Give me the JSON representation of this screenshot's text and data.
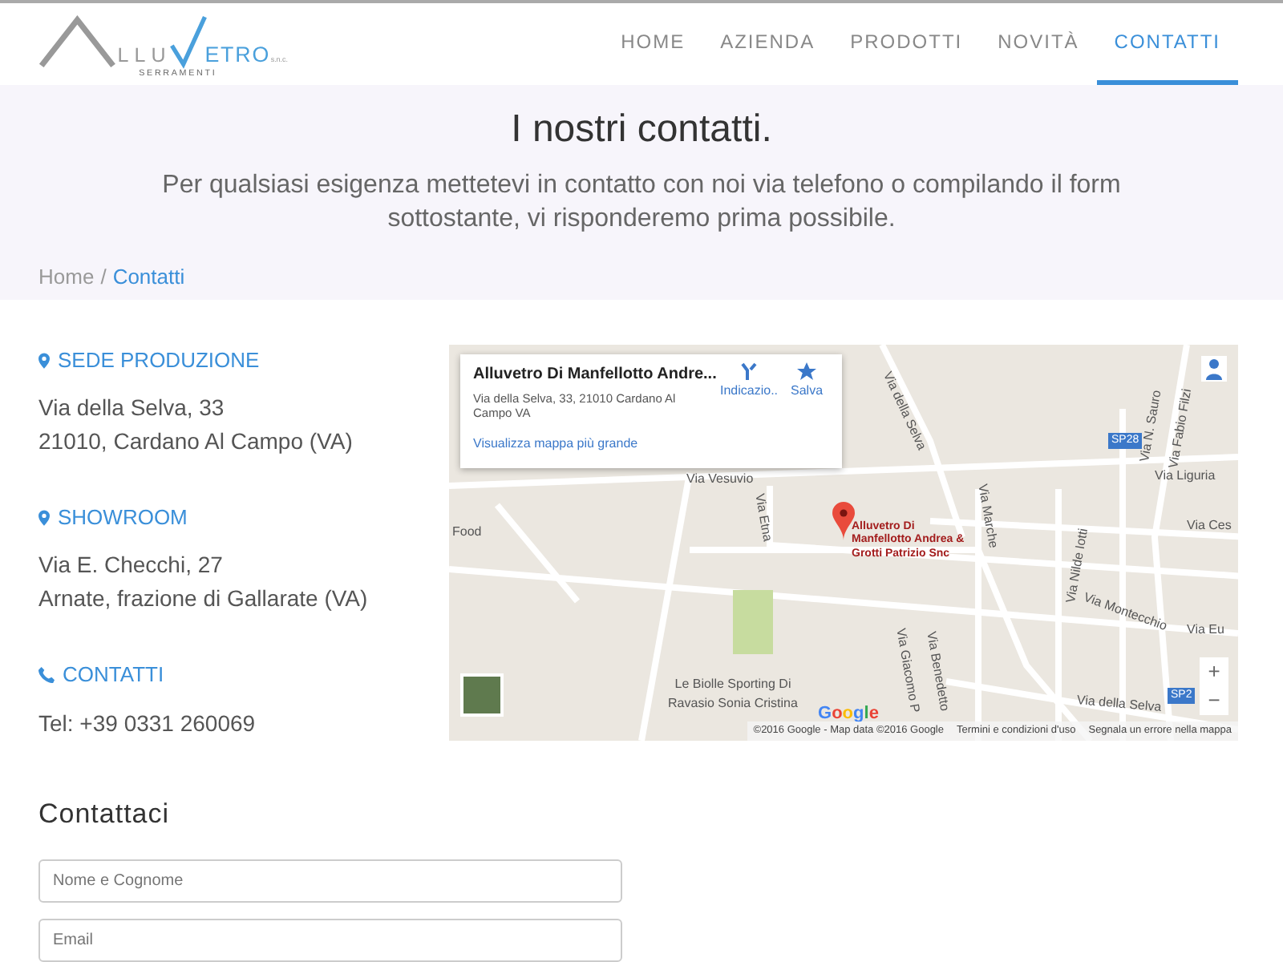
{
  "logo": {
    "text_1": "LLU",
    "text_2": "ETRO",
    "suffix": "s.n.c.",
    "tagline": "SERRAMENTI"
  },
  "nav": [
    {
      "label": "HOME",
      "selected": false
    },
    {
      "label": "AZIENDA",
      "selected": false
    },
    {
      "label": "PRODOTTI",
      "selected": false
    },
    {
      "label": "NOVITÀ",
      "selected": false
    },
    {
      "label": "CONTATTI",
      "selected": true
    }
  ],
  "hero": {
    "title": "I nostri contatti.",
    "subtitle": "Per qualsiasi esigenza mettetevi in contatto con noi via telefono o compilando il form sottostante, vi risponderemo prima possibile."
  },
  "breadcrumb": {
    "separator": "/",
    "items": [
      {
        "label": "Home",
        "selected": false
      },
      {
        "label": "Contatti",
        "selected": true
      }
    ]
  },
  "contacts": [
    {
      "kind": "pin",
      "title": "SEDE PRODUZIONE",
      "lines": [
        "Via della Selva, 33",
        "21010, Cardano Al Campo (VA)"
      ]
    },
    {
      "kind": "pin",
      "title": "SHOWROOM",
      "lines": [
        "Via E. Checchi, 27",
        "Arnate, frazione di Gallarate (VA)"
      ]
    },
    {
      "kind": "phone",
      "title": "CONTATTI",
      "lines": [
        "Tel: +39 0331 260069"
      ]
    }
  ],
  "map": {
    "card": {
      "title": "Alluvetro Di Manfellotto Andre...",
      "address": "Via della Selva, 33, 21010 Cardano Al Campo VA",
      "link": "Visualizza mappa più grande",
      "directions": "Indicazio..",
      "save": "Salva"
    },
    "pin_label": "Alluvetro Di Manfellotto Andrea & Grotti Patrizio Snc",
    "labels": [
      "Via Vesuvio",
      "Via Etna",
      "Via Marche",
      "Via Liguria",
      "Via Montecchio",
      "Via Nilde Iotti",
      "Via Giacomo P",
      "Via Benedetto",
      "Via della Selva",
      "Via della Selva",
      "Via N. Sauro",
      "Via Fabio Filzi",
      "Via Ces",
      "Via Eu",
      "SP28",
      "SP2",
      "Food",
      "Le Biolle Sporting Di Ravasio Sonia Cristina"
    ],
    "zoom_in": "+",
    "zoom_out": "−",
    "brand": "Google",
    "footer": [
      "©2016 Google - Map data ©2016 Google",
      "Termini e condizioni d'uso",
      "Segnala un errore nella mappa"
    ]
  },
  "form": {
    "title": "Contattaci",
    "fields": [
      {
        "placeholder": "Nome e Cognome"
      },
      {
        "placeholder": "Email"
      }
    ]
  }
}
